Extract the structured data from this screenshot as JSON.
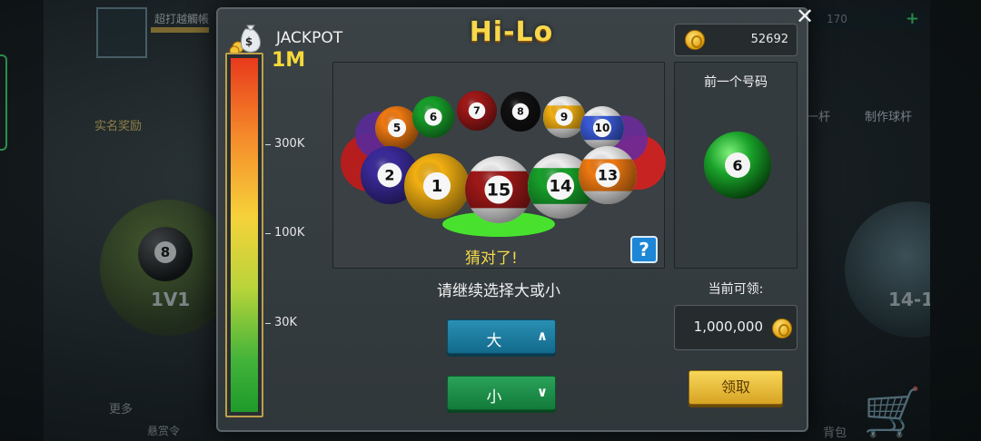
{
  "background": {
    "top_title": "超打越觸帳",
    "coins_partial": "170",
    "award_label": "实名奖励",
    "left_mode": "1V1",
    "right_mode": "14-1",
    "one_cue": "一杆",
    "craft_cue": "制作球杆",
    "more": "更多",
    "bounty": "悬赏令",
    "bag": "背包"
  },
  "modal": {
    "title": "Hi-Lo",
    "coins": "52692",
    "jackpot_label": "JACKPOT",
    "jackpot_top": "1M",
    "meter_ticks": [
      {
        "label": "300K",
        "pos": 0.245
      },
      {
        "label": "100K",
        "pos": 0.495
      },
      {
        "label": "30K",
        "pos": 0.745
      }
    ],
    "meter_fill": 1.0,
    "balls_back": [
      "5",
      "6",
      "7",
      "8",
      "9",
      "10"
    ],
    "balls_front": [
      "2",
      "1",
      "15",
      "14",
      "13"
    ],
    "highlighted_ball": "15",
    "status_text": "猜对了!",
    "help_label": "?",
    "prev_label": "前一个号码",
    "prev_number": "6",
    "prompt": "请继续选择大或小",
    "big_label": "大",
    "small_label": "小",
    "claimable_label": "当前可领:",
    "claimable_value": "1,000,000",
    "claim_label": "领取"
  },
  "colors": {
    "title": "#f8d84a",
    "big_btn": "#1a7ca0",
    "small_btn": "#1d8e48",
    "claim_btn": "#e8bd3a",
    "highlight_glow": "#4bff2a"
  }
}
